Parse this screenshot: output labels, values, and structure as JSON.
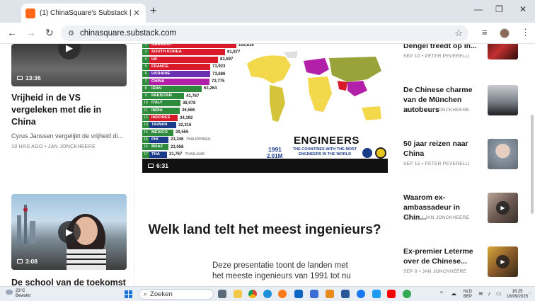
{
  "browser": {
    "tab_title": "(1) ChinaSquare's Substack | Jan",
    "url": "chinasquare.substack.com"
  },
  "left_column": {
    "items": [
      {
        "duration": "13:36",
        "title": "Vrijheid in de VS vergeleken met die in China",
        "subtitle": "Cyrus Janssen vergelijkt de vrijheid di...",
        "meta": "10 HRS AGO • JAN JONCKHEERE"
      },
      {
        "duration": "3:08",
        "title": "De school van de toekomst"
      }
    ]
  },
  "featured": {
    "video_duration": "6:31",
    "headline": "Welk land telt het meest ingenieurs?",
    "description": "Deze presentatie toont de landen met het meeste ingenieurs van 1991 tot nu",
    "video_overlay": {
      "title": "ENGINEERS",
      "subtitle": "THE COUNTRIES WITH THE MOST ENGINEERS IN THE WORLD",
      "year": "1991",
      "total": "2.01M"
    }
  },
  "chart_data": {
    "type": "bar",
    "categories": [
      "GERMANY",
      "SOUTH KOREA",
      "UK",
      "FRANCE",
      "UKRAINE",
      "CHINA",
      "IRAN",
      "PAKISTAN",
      "ITALY",
      "INDIA",
      "INDONESIA",
      "TAIWAN",
      "MEXICO",
      "PHILIPPINES",
      "BRAZIL",
      "THAILAND",
      "NETHERLANDS"
    ],
    "values": [
      105836,
      91977,
      83597,
      73923,
      73686,
      72775,
      63264,
      41767,
      38078,
      36586,
      34192,
      32316,
      29555,
      23246,
      23058,
      21767,
      19440
    ],
    "value_labels": [
      "105,836",
      "91,977",
      "83,597",
      "73,923",
      "73,686",
      "72,775",
      "63,264",
      "41,767",
      "38,078",
      "36,586",
      "34,192",
      "32,316",
      "29,555",
      "23,246",
      "23,058",
      "21,767",
      "19,440"
    ],
    "bar_text": [
      "GERMANY",
      "SOUTH KOREA",
      "UK",
      "FRANCE",
      "UKRAINE",
      "CHINA",
      "IRAN",
      "PAKISTAN",
      "ITALY",
      "INDIA",
      "INDONES",
      "TAIWAN",
      "MEXICO",
      "PHI",
      "BRAZ",
      "THA",
      "NET"
    ],
    "notes": [
      "",
      "",
      "",
      "",
      "",
      "",
      "",
      "",
      "",
      "",
      "",
      "",
      "",
      "PHILIPPINES",
      "",
      "THAILAND",
      "NETHERLANDS"
    ],
    "ranks": [
      "2",
      "3",
      "4",
      "5",
      "6",
      "7",
      "8",
      "9",
      "10",
      "11",
      "12",
      "13",
      "14",
      "15",
      "16",
      "17",
      "18"
    ],
    "bar_colors": [
      "#d91a2a",
      "#d91a2a",
      "#d91a2a",
      "#d91a2a",
      "#6a2fb0",
      "#b21fa8",
      "#2e8b3c",
      "#2e8b3c",
      "#2e8b3c",
      "#2e8b3c",
      "#d91a2a",
      "#1a3b8a",
      "#2e8b3c",
      "#1a3b8a",
      "#2e8b3c",
      "#1a3b8a",
      "#d91a2a"
    ],
    "ylim": [
      0,
      110000
    ]
  },
  "right_column": {
    "items": [
      {
        "title": "Dengel treedt op in...",
        "meta": "SEP 10 • PETER PEVERELLI",
        "has_play": false
      },
      {
        "title": "De Chinese charme van de München autobeurs",
        "meta": "SEP 13 • JAN JONCKHEERE",
        "has_play": false
      },
      {
        "title": "50 jaar reizen naar China",
        "meta": "SEP 15 • PETER PEVERELLI",
        "has_play": false
      },
      {
        "title": "Waarom ex-ambassadeur in Chin...",
        "meta": "SEP 15 • JAN JONCKHEERE",
        "has_play": true
      },
      {
        "title": "Ex-premier Leterme over de Chinese...",
        "meta": "SEP 8 • JAN JONCKHEERE",
        "has_play": true
      }
    ]
  },
  "taskbar": {
    "weather_temp": "23°C",
    "weather_desc": "Bewolkt",
    "search_placeholder": "Zoeken",
    "lang_1": "NLD",
    "lang_2": "BEP",
    "time": "16:25",
    "date": "18/09/2025"
  }
}
